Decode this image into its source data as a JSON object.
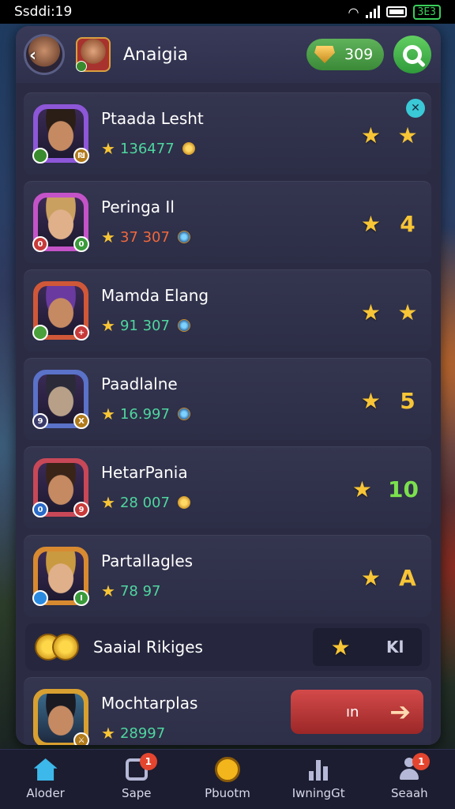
{
  "status_bar": {
    "time": "Ssddi:19",
    "battery_label": "ЗЕЗ"
  },
  "header": {
    "title": "Anaigia",
    "coins": "309"
  },
  "players": [
    {
      "name": "Ptaada Lesht",
      "score": "136477",
      "score_color": "#4fd6a0",
      "gem": "gold",
      "right_value": "★",
      "right_color": "#f7c536",
      "stars": 1,
      "frame": "#8d57d8",
      "face": "#c58a62",
      "hair": "#2a1e16",
      "badge_l": "",
      "badge_r": "₪",
      "badge_l_color": "#3a8a2e",
      "badge_r_color": "#b07a1a",
      "corner": true
    },
    {
      "name": "Peringa Ӏl",
      "score": "37 307",
      "score_color": "#f0683e",
      "gem": "blue",
      "right_value": "4",
      "right_color": "#f7c536",
      "stars": 1,
      "frame": "#c453c8",
      "face": "#e0b08a",
      "hair": "#c9a060",
      "badge_l": "0",
      "badge_r": "0",
      "badge_l_color": "#c83a3a",
      "badge_r_color": "#3a9a3a",
      "corner": false
    },
    {
      "name": "Mamda Elang",
      "score": "91 307",
      "score_color": "#4fd6a0",
      "gem": "blue",
      "right_value": "★",
      "right_color": "#f7c536",
      "stars": 1,
      "frame": "#d05838",
      "face": "#c58a62",
      "hair": "#6a3aa0",
      "badge_l": "",
      "badge_r": "+",
      "badge_l_color": "#4aa03a",
      "badge_r_color": "#c83a3a",
      "corner": false
    },
    {
      "name": "Paadlalne",
      "score": "16.997",
      "score_color": "#4fd6a0",
      "gem": "blue",
      "right_value": "5",
      "right_color": "#f7c536",
      "stars": 1,
      "frame": "#5a72c8",
      "face": "#b8a088",
      "hair": "#2a2a38",
      "badge_l": "9",
      "badge_r": "X",
      "badge_l_color": "#3a3a6a",
      "badge_r_color": "#b07a1a",
      "corner": false
    },
    {
      "name": "HetarPania",
      "score": "28 007",
      "score_color": "#4fd6a0",
      "gem": "gold",
      "right_value": "10",
      "right_color": "#7ce04e",
      "stars": 1,
      "frame": "#c84858",
      "face": "#c58a62",
      "hair": "#3a2418",
      "badge_l": "0",
      "badge_r": "9",
      "badge_l_color": "#2a6ac8",
      "badge_r_color": "#c83a3a",
      "corner": false
    },
    {
      "name": "Partallagles",
      "score": "78 97",
      "score_color": "#4fd6a0",
      "gem": "",
      "right_value": "A",
      "right_color": "#f7c536",
      "stars": 1,
      "frame": "#d88a30",
      "face": "#e0b08a",
      "hair": "#c99a40",
      "badge_l": "",
      "badge_r": "I",
      "badge_l_color": "#2a8ae0",
      "badge_r_color": "#3a9a3a",
      "corner": false
    }
  ],
  "social": {
    "label": "Saaial Rikiges",
    "aux": "Kl"
  },
  "last_player": {
    "name": "Mochtarplas",
    "score": "28997",
    "score_color": "#4fd6a0",
    "button_label": "ın"
  },
  "nav": [
    {
      "label": "Aloder",
      "dot": ""
    },
    {
      "label": "Sape",
      "dot": "1"
    },
    {
      "label": "Pbuotm",
      "dot": ""
    },
    {
      "label": "IwningGt",
      "dot": ""
    },
    {
      "label": "Seaah",
      "dot": "1"
    }
  ],
  "colors": {
    "panel": "#2b2c44",
    "accent_green": "#3b8a38",
    "star": "#f7c536",
    "button_red": "#c13b3b"
  }
}
